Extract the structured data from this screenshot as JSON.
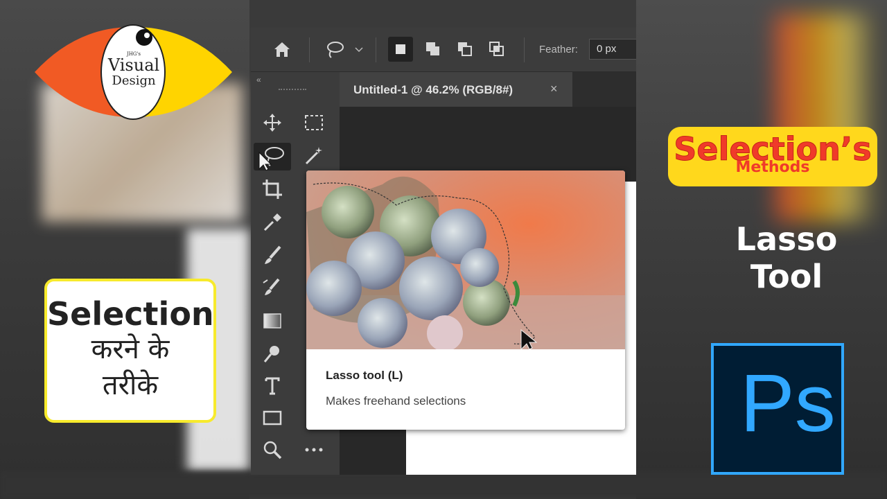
{
  "logo": {
    "brand_small": "JHG's",
    "brand_line1": "Visual",
    "brand_line2": "Design"
  },
  "left_badge": {
    "line1": "Selection",
    "line2": "करने के",
    "line3": "तरीके"
  },
  "right_badge": {
    "title": "Selection’s",
    "subtitle": "Methods"
  },
  "lasso_heading": {
    "line1": "Lasso",
    "line2": "Tool"
  },
  "ps_logo": {
    "text": "Ps"
  },
  "options_bar": {
    "feather_label": "Feather:",
    "feather_value": "0 px",
    "icons": [
      "home-icon",
      "lasso-icon",
      "chevron-down-icon",
      "new-selection-icon",
      "add-to-selection-icon",
      "subtract-from-selection-icon",
      "intersect-selection-icon"
    ]
  },
  "document_tab": {
    "title": "Untitled-1 @ 46.2% (RGB/8#)",
    "close": "×"
  },
  "toolbar": {
    "collapse": "«",
    "tools": [
      "move-tool",
      "marquee-tool",
      "lasso-tool",
      "magic-wand-tool",
      "crop-tool",
      "eyedropper-tool",
      "brush-tool",
      "clone-stamp-tool",
      "gradient-tool",
      "dodge-tool",
      "type-tool",
      "rectangle-tool",
      "zoom-tool",
      "more-tools"
    ]
  },
  "tooltip": {
    "title": "Lasso tool (L)",
    "description": "Makes freehand selections"
  },
  "colors": {
    "ps_blue": "#31a8ff",
    "ps_dark": "#001d34",
    "badge_yellow": "#ffd81c",
    "badge_red": "#f03a2a",
    "logo_orange": "#f15a24",
    "logo_yellow": "#ffd400"
  }
}
